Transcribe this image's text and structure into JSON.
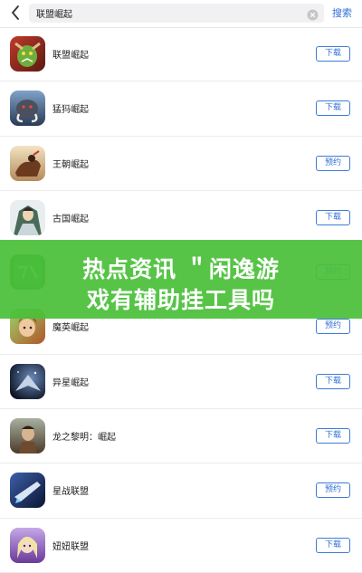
{
  "search": {
    "query": "联盟崛起",
    "submit_label": "搜索"
  },
  "buttons": {
    "download": "下载",
    "reserve": "预约"
  },
  "apps": [
    {
      "name": "联盟崛起",
      "action": "下载",
      "icon": "orc-warrior-icon"
    },
    {
      "name": "猛犸崛起",
      "action": "下载",
      "icon": "mammoth-icon"
    },
    {
      "name": "王朝崛起",
      "action": "预约",
      "icon": "dynasty-icon"
    },
    {
      "name": "古国崛起",
      "action": "下载",
      "icon": "ancient-kingdom-icon"
    },
    {
      "name": "",
      "action": "预约",
      "icon": "war-game-icon"
    },
    {
      "name": "魔英崛起",
      "action": "预约",
      "icon": "magic-hero-icon"
    },
    {
      "name": "异星崛起",
      "action": "下载",
      "icon": "alien-star-icon"
    },
    {
      "name": "龙之黎明：崛起",
      "action": "下载",
      "icon": "dragon-dawn-icon"
    },
    {
      "name": "星战联盟",
      "action": "预约",
      "icon": "star-war-icon"
    },
    {
      "name": "妞妞联盟",
      "action": "下载",
      "icon": "girl-alliance-icon"
    }
  ],
  "banner": {
    "line1": "热点资讯 ＂闲逸游",
    "line2": "戏有辅助挂工具吗"
  },
  "colors": {
    "accent": "#2f6fd6",
    "banner_green": "#4abf3a"
  }
}
